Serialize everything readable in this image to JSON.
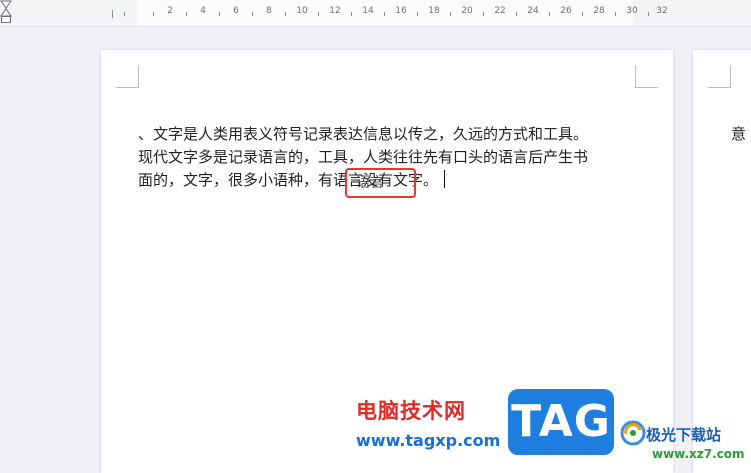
{
  "ruler": {
    "labels": [
      "2",
      "4",
      "6",
      "8",
      "10",
      "12",
      "14",
      "16",
      "18",
      "20",
      "22",
      "24",
      "26",
      "28",
      "30",
      "32"
    ]
  },
  "document": {
    "lines": [
      "、文字是人类用表义符号记录表达信息以传之，久远的方式和工具。",
      "现代文字多是记录语言的，工具，人类往往先有口头的语言后产生书",
      "面的，文字，很多小语种，有语言没有文字。"
    ],
    "drag_ghost": "语言",
    "next_page_text": "意"
  },
  "watermark": {
    "site_name": "电脑技术网",
    "site_url": "www.tagxp.com",
    "tag_logo": "TAG",
    "jg_name": "极光下载站",
    "jg_url": "www.xz7.com"
  },
  "colors": {
    "highlight": "#e53935",
    "watermark_red": "#e02a27",
    "watermark_blue": "#1a6fd6",
    "tag_blue": "#1e7fe0"
  }
}
